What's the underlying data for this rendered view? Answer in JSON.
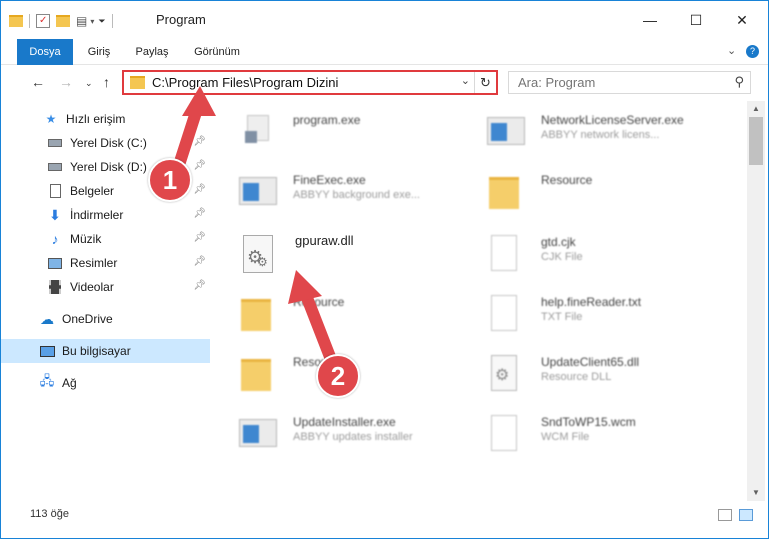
{
  "window": {
    "title": "Program",
    "minimize": "—",
    "maximize": "☐",
    "close": "✕"
  },
  "ribbon": {
    "tabs": [
      "Dosya",
      "Giriş",
      "Paylaş",
      "Görünüm"
    ]
  },
  "address": {
    "path": "C:\\Program Files\\Program Dizini"
  },
  "search": {
    "placeholder": "Ara: Program"
  },
  "sidebar": {
    "items": [
      {
        "label": "Hızlı erişim",
        "icon": "star-icon"
      },
      {
        "label": "Yerel Disk (C:)",
        "icon": "drive-icon"
      },
      {
        "label": "Yerel Disk (D:)",
        "icon": "drive-icon"
      },
      {
        "label": "Belgeler",
        "icon": "documents-icon"
      },
      {
        "label": "İndirmeler",
        "icon": "downloads-icon"
      },
      {
        "label": "Müzik",
        "icon": "music-icon"
      },
      {
        "label": "Resimler",
        "icon": "pictures-icon"
      },
      {
        "label": "Videolar",
        "icon": "videos-icon"
      },
      {
        "label": "OneDrive",
        "icon": "cloud-icon"
      },
      {
        "label": "Bu bilgisayar",
        "icon": "computer-icon"
      },
      {
        "label": "Ağ",
        "icon": "network-icon"
      }
    ]
  },
  "files": {
    "left": [
      {
        "name": "program.exe",
        "desc": ""
      },
      {
        "name": "FineExec.exe",
        "desc": "ABBYY background exe..."
      },
      {
        "name": "gpuraw.dll",
        "desc": ""
      },
      {
        "name": "Resource",
        "desc": ""
      },
      {
        "name": "Resource",
        "desc": ""
      },
      {
        "name": "UpdateInstaller.exe",
        "desc": "ABBYY updates installer"
      }
    ],
    "right": [
      {
        "name": "NetworkLicenseServer.exe",
        "desc": "ABBYY network licens..."
      },
      {
        "name": "Resource",
        "desc": ""
      },
      {
        "name": "gtd.cjk",
        "desc": "CJK File"
      },
      {
        "name": "help.fineReader.txt",
        "desc": "TXT File"
      },
      {
        "name": "UpdateClient65.dll",
        "desc": "Resource DLL"
      },
      {
        "name": "SndToWP15.wcm",
        "desc": "WCM File"
      }
    ]
  },
  "status": {
    "count": "113 öğe"
  },
  "annotations": {
    "step1": "1",
    "step2": "2"
  },
  "colors": {
    "accent": "#1979ca",
    "highlight": "#e03a3e",
    "selected": "#cce8ff"
  }
}
